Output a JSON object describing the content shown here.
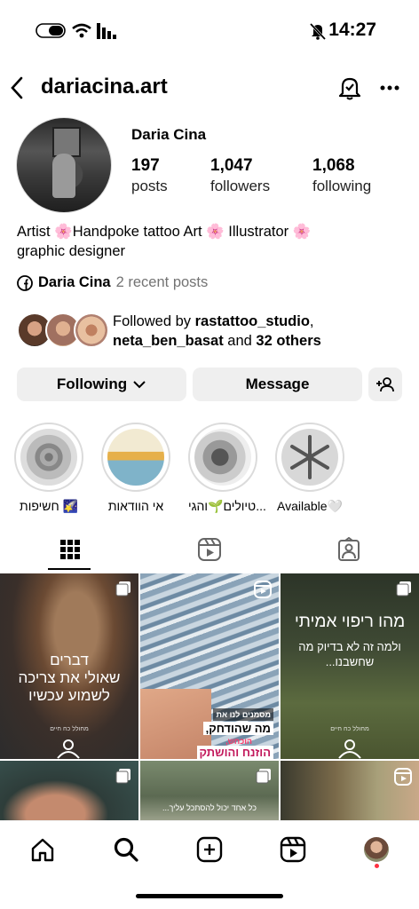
{
  "status_bar": {
    "time": "14:27"
  },
  "header": {
    "username": "dariacina.art"
  },
  "profile": {
    "full_name": "Daria Cina",
    "stats": [
      {
        "value": "197",
        "label": "posts"
      },
      {
        "value": "1,047",
        "label": "followers"
      },
      {
        "value": "1,068",
        "label": "following"
      }
    ],
    "bio_line1": "Artist 🌸Handpoke tattoo Art 🌸 Illustrator 🌸",
    "bio_line2": "graphic designer",
    "fb_name": "Daria Cina",
    "fb_recent": "2 recent posts",
    "followed_prefix": "Followed by ",
    "followed_user1": "rastattoo_studio",
    "followed_comma": ",",
    "followed_user2": "neta_ben_basat",
    "followed_and": " and ",
    "followed_others": "32 others"
  },
  "actions": {
    "following_label": "Following",
    "message_label": "Message"
  },
  "highlights": [
    {
      "label": "חשיפות 🌠"
    },
    {
      "label": "אי הוודאות"
    },
    {
      "label": "טיולים🌱והגי..."
    },
    {
      "label": "Available🤍"
    }
  ],
  "grid": {
    "post1": {
      "line1": "דברים",
      "line2": "שאולי את צריכה",
      "line3": "לשמוע עכשיו",
      "footer": "מחולל כח חיים"
    },
    "post2": {
      "line1": "מסמנים לנו את",
      "line2": "מה שהודחק,",
      "line3": "הוכחש,",
      "line4": "הוזנח והושתק"
    },
    "post3": {
      "line1": "מהו ריפוי אמיתי",
      "line2": "ולמה זה לא בדיוק מה",
      "line3": "שחשבנו...",
      "footer": "מחולל כח חיים"
    },
    "post5": {
      "line1": "כל אחד יכול להסתכל עליך..."
    }
  }
}
